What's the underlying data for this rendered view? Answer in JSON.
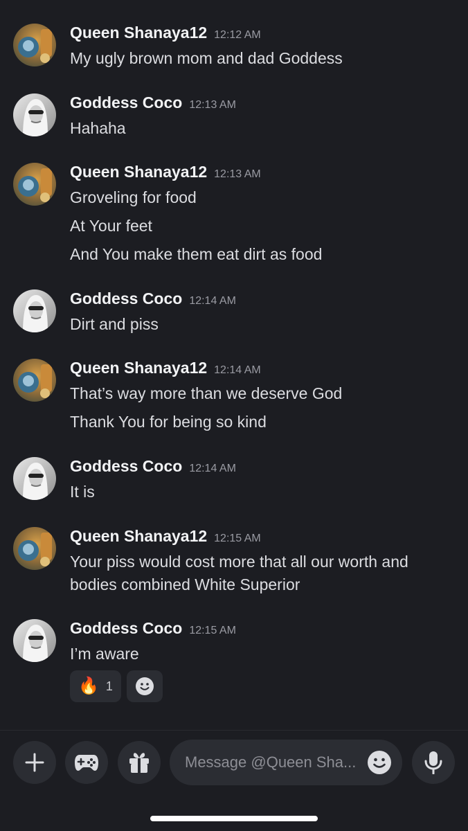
{
  "messages": [
    {
      "author": "Queen Shanaya12",
      "time": "12:12 AM",
      "avatar": "avatar-queen-shanaya",
      "lines": [
        "My ugly brown mom and dad Goddess"
      ]
    },
    {
      "author": "Goddess Coco",
      "time": "12:13 AM",
      "avatar": "avatar-goddess-coco",
      "lines": [
        "Hahaha"
      ]
    },
    {
      "author": "Queen Shanaya12",
      "time": "12:13 AM",
      "avatar": "avatar-queen-shanaya",
      "lines": [
        "Groveling for food",
        "At Your feet",
        "And You make them eat dirt as food"
      ]
    },
    {
      "author": "Goddess Coco",
      "time": "12:14 AM",
      "avatar": "avatar-goddess-coco",
      "lines": [
        "Dirt and piss"
      ]
    },
    {
      "author": "Queen Shanaya12",
      "time": "12:14 AM",
      "avatar": "avatar-queen-shanaya",
      "lines": [
        "That’s way more than we deserve God",
        "Thank You for being so kind"
      ]
    },
    {
      "author": "Goddess Coco",
      "time": "12:14 AM",
      "avatar": "avatar-goddess-coco",
      "lines": [
        "It is"
      ]
    },
    {
      "author": "Queen Shanaya12",
      "time": "12:15 AM",
      "avatar": "avatar-queen-shanaya",
      "lines": [
        "Your piss would cost more that all our worth and",
        "bodies combined White Superior"
      ]
    },
    {
      "author": "Goddess Coco",
      "time": "12:15 AM",
      "avatar": "avatar-goddess-coco",
      "lines": [
        "I’m aware"
      ]
    }
  ],
  "reactions": {
    "fire": {
      "emoji": "🔥",
      "count": "1",
      "icon": "fire-icon"
    },
    "add": {
      "icon": "add-reaction-smiley-icon"
    }
  },
  "composer": {
    "placeholder": "Message @Queen Sha...",
    "buttons": [
      "plus-icon",
      "gamepad-icon",
      "gift-icon",
      "emoji-icon",
      "microphone-icon"
    ]
  },
  "colors": {
    "background": "#1c1d22",
    "surface": "#2b2d33",
    "author": "#f2f3f5",
    "text": "#dcdde1",
    "timestamp": "#9a9ba3"
  }
}
